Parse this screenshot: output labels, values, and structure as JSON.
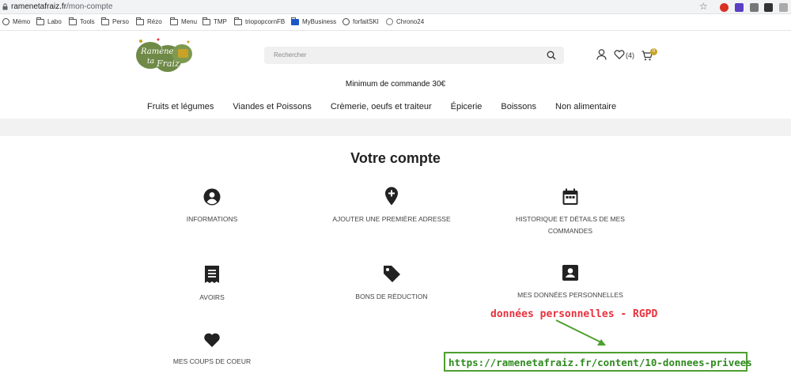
{
  "browser": {
    "url_host": "ramenetafraiz.fr",
    "url_path": "/mon-compte",
    "bookmarks": [
      "Mémo",
      "Labo",
      "Tools",
      "Perso",
      "Rézo",
      "Menu",
      "TMP",
      "triopopcornFB",
      "MyBusiness",
      "forfaitSKI",
      "Chrono24"
    ]
  },
  "header": {
    "search_placeholder": "Rechercher",
    "wishlist_count": "(4)",
    "cart_count": "0",
    "minimum_notice": "Minimum de commande 30€"
  },
  "nav": [
    "Fruits et légumes",
    "Viandes et Poissons",
    "Crèmerie, oeufs et traiteur",
    "Épicerie",
    "Boissons",
    "Non alimentaire"
  ],
  "account": {
    "title": "Votre compte",
    "tiles": {
      "info": "INFORMATIONS",
      "address": "AJOUTER UNE PREMIÈRE ADRESSE",
      "orders_1": "HISTORIQUE ET DÉTAILS DE MES",
      "orders_2": "COMMANDES",
      "credits": "AVOIRS",
      "vouchers": "BONS DE RÉDUCTION",
      "personal": "MES DONNÉES PERSONNELLES",
      "wishlist": "MES COUPS DE COEUR"
    }
  },
  "annotations": {
    "label": "données personnelles - RGPD",
    "link": "https://ramenetafraiz.fr/content/10-donnees-privees",
    "label_color": "#e8303c",
    "box_color": "#4ea02f"
  },
  "colors": {
    "accent": "#c9a227",
    "logo_green": "#6e8a46"
  },
  "icons": [
    "lock-icon",
    "star-icon",
    "folder-icon",
    "globe-icon",
    "search-icon",
    "user-icon",
    "heart-icon",
    "cart-icon",
    "account-circle-icon",
    "add-location-icon",
    "calendar-icon",
    "receipt-icon",
    "tag-icon",
    "id-card-icon"
  ]
}
